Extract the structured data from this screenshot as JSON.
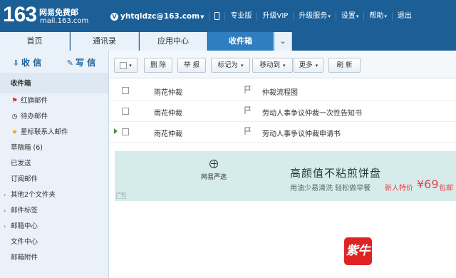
{
  "header": {
    "logo_number": "163",
    "logo_name": "网易免费邮",
    "logo_url": "mail.163.com",
    "vip_badge": "V",
    "email": "yhtqldzc@163.com",
    "links": [
      "专业版",
      "升级VIP",
      "升级服务",
      "设置",
      "帮助",
      "退出"
    ]
  },
  "tabs": [
    "首页",
    "通讯录",
    "应用中心",
    "收件箱",
    "⌄"
  ],
  "sidebar": {
    "receive": "收 信",
    "compose": "写 信",
    "folders": [
      "收件箱",
      "红旗邮件",
      "待办邮件",
      "星标联系人邮件",
      "草稿箱 (6)",
      "已发送",
      "订阅邮件",
      "其他2个文件夹",
      "邮件标签",
      "邮箱中心",
      "文件中心",
      "邮箱附件"
    ]
  },
  "toolbar": {
    "delete": "删 除",
    "report": "举 报",
    "mark": "标记为",
    "move": "移动到",
    "more": "更多",
    "refresh": "刷 新"
  },
  "emails": [
    {
      "sender": "雨花仲裁",
      "subject": "仲裁流程图"
    },
    {
      "sender": "雨花仲裁",
      "subject": "劳动人事争议仲裁一次性告知书"
    },
    {
      "sender": "雨花仲裁",
      "subject": "劳动人事争议仲裁申请书"
    }
  ],
  "ad": {
    "brand": "网易严选",
    "title": "高颜值不粘煎饼盘",
    "subtitle": "用油少易清洗  轻松做早餐",
    "price_label": "新人特价",
    "price": "¥69",
    "postfix": "包邮",
    "corner": "广告"
  },
  "stamp": "紫牛",
  "colors": {
    "brand_blue": "#1c5f97",
    "ad_bg": "#d6ecea",
    "price_red": "#e0454a"
  }
}
